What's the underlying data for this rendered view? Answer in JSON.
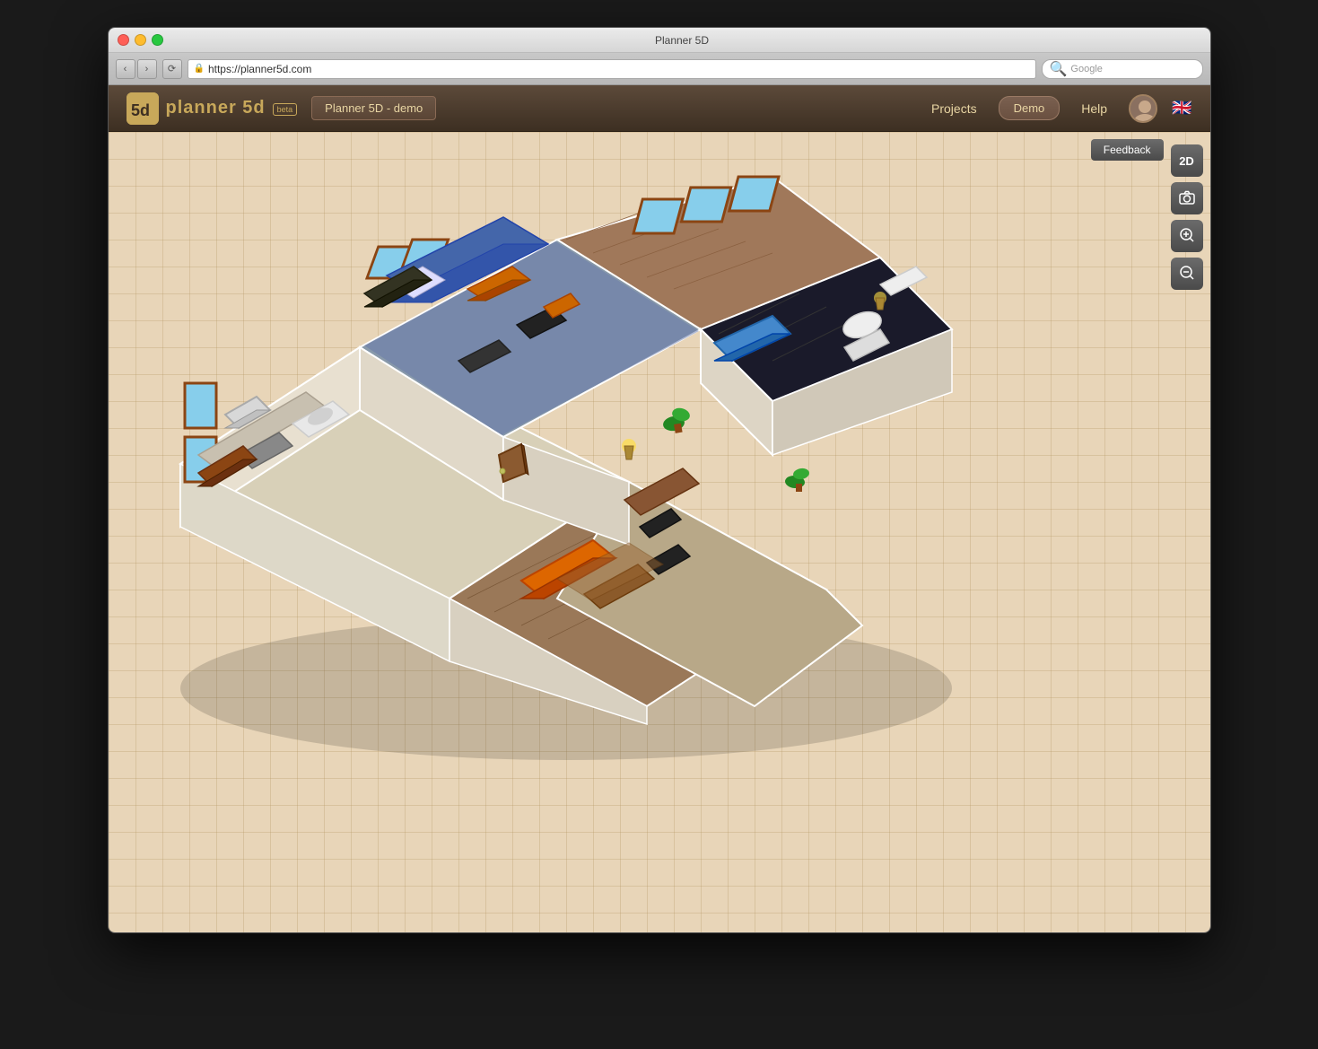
{
  "window": {
    "title": "Planner 5D",
    "titlebar_title": "Planner 5D"
  },
  "browser": {
    "url": "https://planner5d.com",
    "search_placeholder": "Google",
    "nav_back": "‹",
    "nav_forward": "›",
    "reload": "↺"
  },
  "app": {
    "logo_text_plain": "planner",
    "logo_text_brand": "5d",
    "logo_number": "5d",
    "beta_label": "beta",
    "project_name": "Planner 5D - demo",
    "nav_projects": "Projects",
    "nav_demo": "Demo",
    "nav_help": "Help"
  },
  "canvas": {
    "feedback_label": "Feedback",
    "toolbar_2d": "2D",
    "toolbar_camera": "📷",
    "toolbar_zoom_in": "🔍+",
    "toolbar_zoom_out": "🔍-"
  },
  "icons": {
    "back_arrow": "‹",
    "forward_arrow": "›",
    "reload": "⟳",
    "search": "🔍",
    "lock": "🔒",
    "camera": "⊙",
    "zoom_in": "⊕",
    "zoom_out": "⊖"
  }
}
